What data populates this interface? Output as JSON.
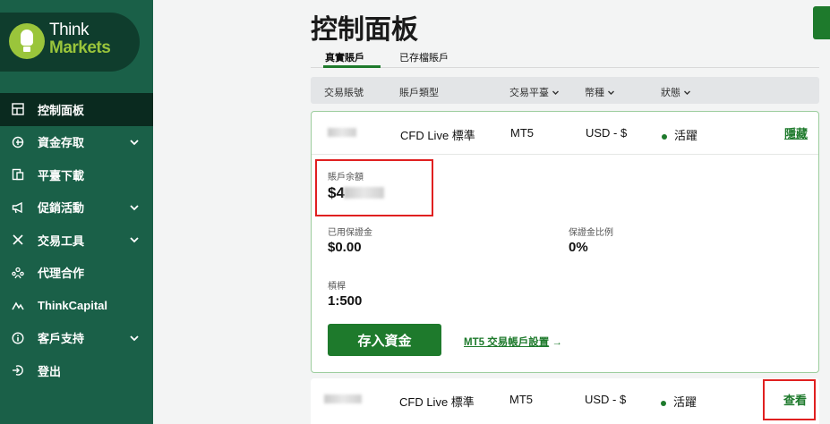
{
  "brand": {
    "think": "Think",
    "markets": "Markets"
  },
  "sidebar": {
    "items": [
      {
        "label": "控制面板",
        "icon": "dashboard-icon",
        "active": true,
        "expandable": false
      },
      {
        "label": "資金存取",
        "icon": "wallet-icon",
        "active": false,
        "expandable": true
      },
      {
        "label": "平臺下載",
        "icon": "download-icon",
        "active": false,
        "expandable": false
      },
      {
        "label": "促銷活動",
        "icon": "megaphone-icon",
        "active": false,
        "expandable": true
      },
      {
        "label": "交易工具",
        "icon": "tools-icon",
        "active": false,
        "expandable": true
      },
      {
        "label": "代理合作",
        "icon": "partners-icon",
        "active": false,
        "expandable": false
      },
      {
        "label": "ThinkCapital",
        "icon": "capital-icon",
        "active": false,
        "expandable": false
      },
      {
        "label": "客戶支持",
        "icon": "info-icon",
        "active": false,
        "expandable": true
      },
      {
        "label": "登出",
        "icon": "logout-icon",
        "active": false,
        "expandable": false
      }
    ]
  },
  "page": {
    "title": "控制面板"
  },
  "tabs": [
    {
      "label": "真實賬戶",
      "active": true
    },
    {
      "label": "已存檔賬戶",
      "active": false
    }
  ],
  "table": {
    "headers": {
      "account": "交易賬號",
      "type": "賬戶類型",
      "platform": "交易平臺",
      "currency": "幣種",
      "status": "狀態"
    }
  },
  "accounts": [
    {
      "type": "CFD Live 標準",
      "platform": "MT5",
      "currency": "USD - $",
      "status": "活躍",
      "action": "隱藏",
      "balance_label": "賬戶余額",
      "balance_prefix": "$4",
      "margin_label": "已用保證金",
      "margin_value": "$0.00",
      "margin_ratio_label": "保證金比例",
      "margin_ratio_value": "0%",
      "leverage_label": "槓桿",
      "leverage_value": "1:500",
      "deposit_label": "存入資金",
      "settings_link": "MT5 交易帳戶設置",
      "settings_arrow": "→"
    },
    {
      "type": "CFD Live 標準",
      "platform": "MT5",
      "currency": "USD - $",
      "status": "活躍",
      "action": "查看"
    }
  ],
  "colors": {
    "sidebar": "#1a6048",
    "accent": "#1e7a2c",
    "highlight": "#e02020"
  }
}
